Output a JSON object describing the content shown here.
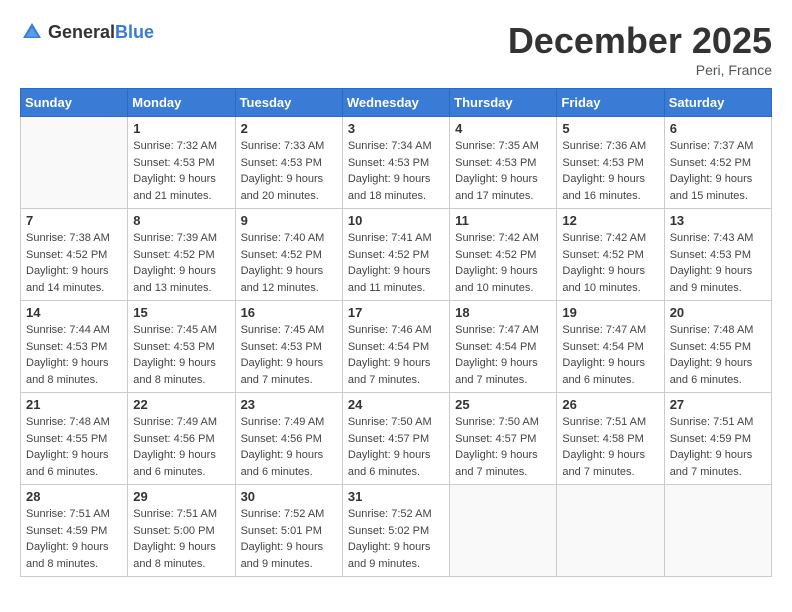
{
  "header": {
    "logo_general": "General",
    "logo_blue": "Blue",
    "month_title": "December 2025",
    "location": "Peri, France"
  },
  "days_of_week": [
    "Sunday",
    "Monday",
    "Tuesday",
    "Wednesday",
    "Thursday",
    "Friday",
    "Saturday"
  ],
  "weeks": [
    [
      {
        "num": "",
        "sunrise": "",
        "sunset": "",
        "daylight": ""
      },
      {
        "num": "1",
        "sunrise": "Sunrise: 7:32 AM",
        "sunset": "Sunset: 4:53 PM",
        "daylight": "Daylight: 9 hours and 21 minutes."
      },
      {
        "num": "2",
        "sunrise": "Sunrise: 7:33 AM",
        "sunset": "Sunset: 4:53 PM",
        "daylight": "Daylight: 9 hours and 20 minutes."
      },
      {
        "num": "3",
        "sunrise": "Sunrise: 7:34 AM",
        "sunset": "Sunset: 4:53 PM",
        "daylight": "Daylight: 9 hours and 18 minutes."
      },
      {
        "num": "4",
        "sunrise": "Sunrise: 7:35 AM",
        "sunset": "Sunset: 4:53 PM",
        "daylight": "Daylight: 9 hours and 17 minutes."
      },
      {
        "num": "5",
        "sunrise": "Sunrise: 7:36 AM",
        "sunset": "Sunset: 4:53 PM",
        "daylight": "Daylight: 9 hours and 16 minutes."
      },
      {
        "num": "6",
        "sunrise": "Sunrise: 7:37 AM",
        "sunset": "Sunset: 4:52 PM",
        "daylight": "Daylight: 9 hours and 15 minutes."
      }
    ],
    [
      {
        "num": "7",
        "sunrise": "Sunrise: 7:38 AM",
        "sunset": "Sunset: 4:52 PM",
        "daylight": "Daylight: 9 hours and 14 minutes."
      },
      {
        "num": "8",
        "sunrise": "Sunrise: 7:39 AM",
        "sunset": "Sunset: 4:52 PM",
        "daylight": "Daylight: 9 hours and 13 minutes."
      },
      {
        "num": "9",
        "sunrise": "Sunrise: 7:40 AM",
        "sunset": "Sunset: 4:52 PM",
        "daylight": "Daylight: 9 hours and 12 minutes."
      },
      {
        "num": "10",
        "sunrise": "Sunrise: 7:41 AM",
        "sunset": "Sunset: 4:52 PM",
        "daylight": "Daylight: 9 hours and 11 minutes."
      },
      {
        "num": "11",
        "sunrise": "Sunrise: 7:42 AM",
        "sunset": "Sunset: 4:52 PM",
        "daylight": "Daylight: 9 hours and 10 minutes."
      },
      {
        "num": "12",
        "sunrise": "Sunrise: 7:42 AM",
        "sunset": "Sunset: 4:52 PM",
        "daylight": "Daylight: 9 hours and 10 minutes."
      },
      {
        "num": "13",
        "sunrise": "Sunrise: 7:43 AM",
        "sunset": "Sunset: 4:53 PM",
        "daylight": "Daylight: 9 hours and 9 minutes."
      }
    ],
    [
      {
        "num": "14",
        "sunrise": "Sunrise: 7:44 AM",
        "sunset": "Sunset: 4:53 PM",
        "daylight": "Daylight: 9 hours and 8 minutes."
      },
      {
        "num": "15",
        "sunrise": "Sunrise: 7:45 AM",
        "sunset": "Sunset: 4:53 PM",
        "daylight": "Daylight: 9 hours and 8 minutes."
      },
      {
        "num": "16",
        "sunrise": "Sunrise: 7:45 AM",
        "sunset": "Sunset: 4:53 PM",
        "daylight": "Daylight: 9 hours and 7 minutes."
      },
      {
        "num": "17",
        "sunrise": "Sunrise: 7:46 AM",
        "sunset": "Sunset: 4:54 PM",
        "daylight": "Daylight: 9 hours and 7 minutes."
      },
      {
        "num": "18",
        "sunrise": "Sunrise: 7:47 AM",
        "sunset": "Sunset: 4:54 PM",
        "daylight": "Daylight: 9 hours and 7 minutes."
      },
      {
        "num": "19",
        "sunrise": "Sunrise: 7:47 AM",
        "sunset": "Sunset: 4:54 PM",
        "daylight": "Daylight: 9 hours and 6 minutes."
      },
      {
        "num": "20",
        "sunrise": "Sunrise: 7:48 AM",
        "sunset": "Sunset: 4:55 PM",
        "daylight": "Daylight: 9 hours and 6 minutes."
      }
    ],
    [
      {
        "num": "21",
        "sunrise": "Sunrise: 7:48 AM",
        "sunset": "Sunset: 4:55 PM",
        "daylight": "Daylight: 9 hours and 6 minutes."
      },
      {
        "num": "22",
        "sunrise": "Sunrise: 7:49 AM",
        "sunset": "Sunset: 4:56 PM",
        "daylight": "Daylight: 9 hours and 6 minutes."
      },
      {
        "num": "23",
        "sunrise": "Sunrise: 7:49 AM",
        "sunset": "Sunset: 4:56 PM",
        "daylight": "Daylight: 9 hours and 6 minutes."
      },
      {
        "num": "24",
        "sunrise": "Sunrise: 7:50 AM",
        "sunset": "Sunset: 4:57 PM",
        "daylight": "Daylight: 9 hours and 6 minutes."
      },
      {
        "num": "25",
        "sunrise": "Sunrise: 7:50 AM",
        "sunset": "Sunset: 4:57 PM",
        "daylight": "Daylight: 9 hours and 7 minutes."
      },
      {
        "num": "26",
        "sunrise": "Sunrise: 7:51 AM",
        "sunset": "Sunset: 4:58 PM",
        "daylight": "Daylight: 9 hours and 7 minutes."
      },
      {
        "num": "27",
        "sunrise": "Sunrise: 7:51 AM",
        "sunset": "Sunset: 4:59 PM",
        "daylight": "Daylight: 9 hours and 7 minutes."
      }
    ],
    [
      {
        "num": "28",
        "sunrise": "Sunrise: 7:51 AM",
        "sunset": "Sunset: 4:59 PM",
        "daylight": "Daylight: 9 hours and 8 minutes."
      },
      {
        "num": "29",
        "sunrise": "Sunrise: 7:51 AM",
        "sunset": "Sunset: 5:00 PM",
        "daylight": "Daylight: 9 hours and 8 minutes."
      },
      {
        "num": "30",
        "sunrise": "Sunrise: 7:52 AM",
        "sunset": "Sunset: 5:01 PM",
        "daylight": "Daylight: 9 hours and 9 minutes."
      },
      {
        "num": "31",
        "sunrise": "Sunrise: 7:52 AM",
        "sunset": "Sunset: 5:02 PM",
        "daylight": "Daylight: 9 hours and 9 minutes."
      },
      {
        "num": "",
        "sunrise": "",
        "sunset": "",
        "daylight": ""
      },
      {
        "num": "",
        "sunrise": "",
        "sunset": "",
        "daylight": ""
      },
      {
        "num": "",
        "sunrise": "",
        "sunset": "",
        "daylight": ""
      }
    ]
  ]
}
